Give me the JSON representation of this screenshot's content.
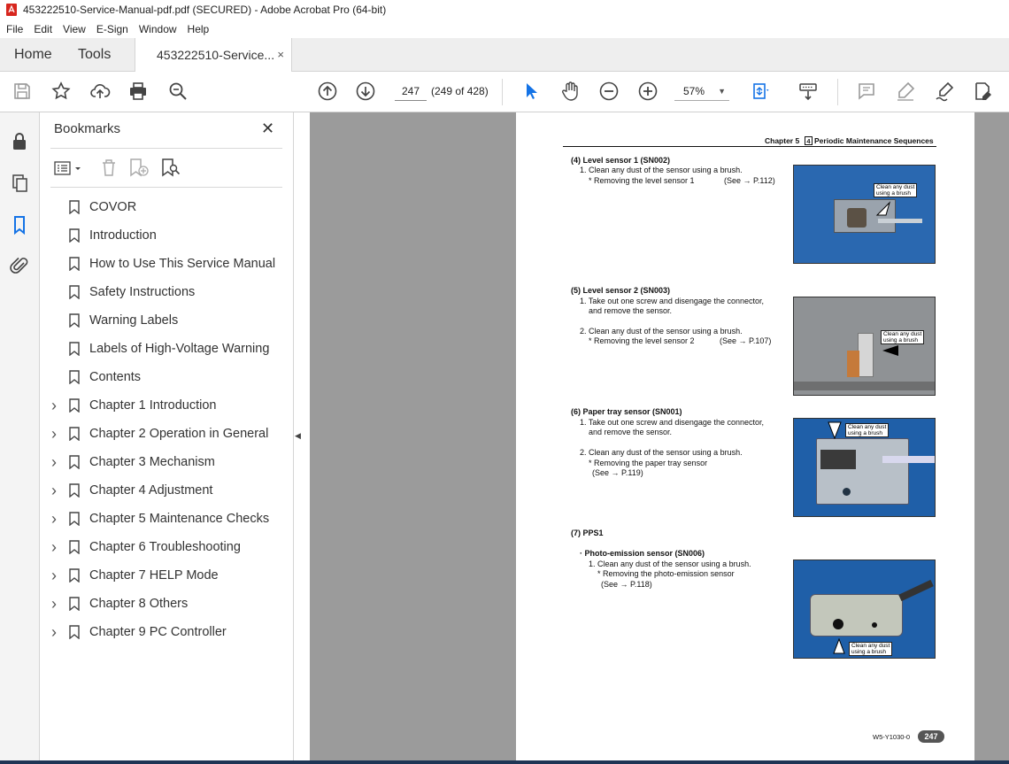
{
  "window": {
    "title": "453222510-Service-Manual-pdf.pdf (SECURED) - Adobe Acrobat Pro (64-bit)"
  },
  "menu": [
    "File",
    "Edit",
    "View",
    "E-Sign",
    "Window",
    "Help"
  ],
  "tabs": {
    "home": "Home",
    "tools": "Tools",
    "document": "453222510-Service...",
    "close": "×"
  },
  "toolbar": {
    "page_current": "247",
    "page_of": "(249 of 428)",
    "zoom": "57%"
  },
  "bookmarks": {
    "title": "Bookmarks",
    "close": "✕",
    "items": [
      {
        "label": "COVOR",
        "expandable": false
      },
      {
        "label": "Introduction",
        "expandable": false
      },
      {
        "label": "How to Use This Service Manual",
        "expandable": false
      },
      {
        "label": "Safety Instructions",
        "expandable": false
      },
      {
        "label": "Warning Labels",
        "expandable": false
      },
      {
        "label": "Labels of High-Voltage Warning",
        "expandable": false
      },
      {
        "label": "Contents",
        "expandable": false
      },
      {
        "label": "Chapter 1 Introduction",
        "expandable": true
      },
      {
        "label": "Chapter 2 Operation in General",
        "expandable": true
      },
      {
        "label": "Chapter 3 Mechanism",
        "expandable": true
      },
      {
        "label": "Chapter 4 Adjustment",
        "expandable": true
      },
      {
        "label": "Chapter 5 Maintenance Checks",
        "expandable": true
      },
      {
        "label": "Chapter 6 Troubleshooting",
        "expandable": true
      },
      {
        "label": "Chapter 7 HELP Mode",
        "expandable": true
      },
      {
        "label": "Chapter 8 Others",
        "expandable": true
      },
      {
        "label": "Chapter 9 PC Controller",
        "expandable": true
      }
    ]
  },
  "page": {
    "header_left": "Chapter 5",
    "header_num": "4",
    "header_right": "Periodic Maintenance Sequences",
    "chapter_tab": "5",
    "footer_code": "W5-Y1030-0",
    "footer_page": "247",
    "callout": "Clean any dust\nusing a brush",
    "s4": {
      "title": "(4) Level sensor 1 (SN002)",
      "l1": "1. Clean any dust of the sensor using a brush.",
      "l2": "* Removing the level sensor 1",
      "l2ref": "(See → P.112)"
    },
    "s5": {
      "title": "(5) Level sensor 2 (SN003)",
      "l1": "1. Take out one screw and disengage the connector,",
      "l1b": "and remove the sensor.",
      "l2": "2. Clean any dust of the sensor using a brush.",
      "l3": "* Removing the level sensor 2",
      "l3ref": "(See → P.107)"
    },
    "s6": {
      "title": "(6) Paper tray sensor (SN001)",
      "l1": "1. Take out one screw and disengage the connector,",
      "l1b": "and remove the sensor.",
      "l2": "2. Clean any dust of the sensor using a brush.",
      "l3": "* Removing the paper tray sensor",
      "l3ref": "(See → P.119)"
    },
    "s7": {
      "title": "(7) PPS1",
      "sub": "· Photo-emission sensor (SN006)",
      "l1": "1. Clean any dust of the sensor using a brush.",
      "l2": "* Removing the photo-emission sensor",
      "l2ref": "(See → P.118)"
    }
  },
  "colors": {
    "accent": "#1473e6",
    "doc_bg": "#9b9b9b",
    "photo_blue": "#1f5fa8"
  }
}
